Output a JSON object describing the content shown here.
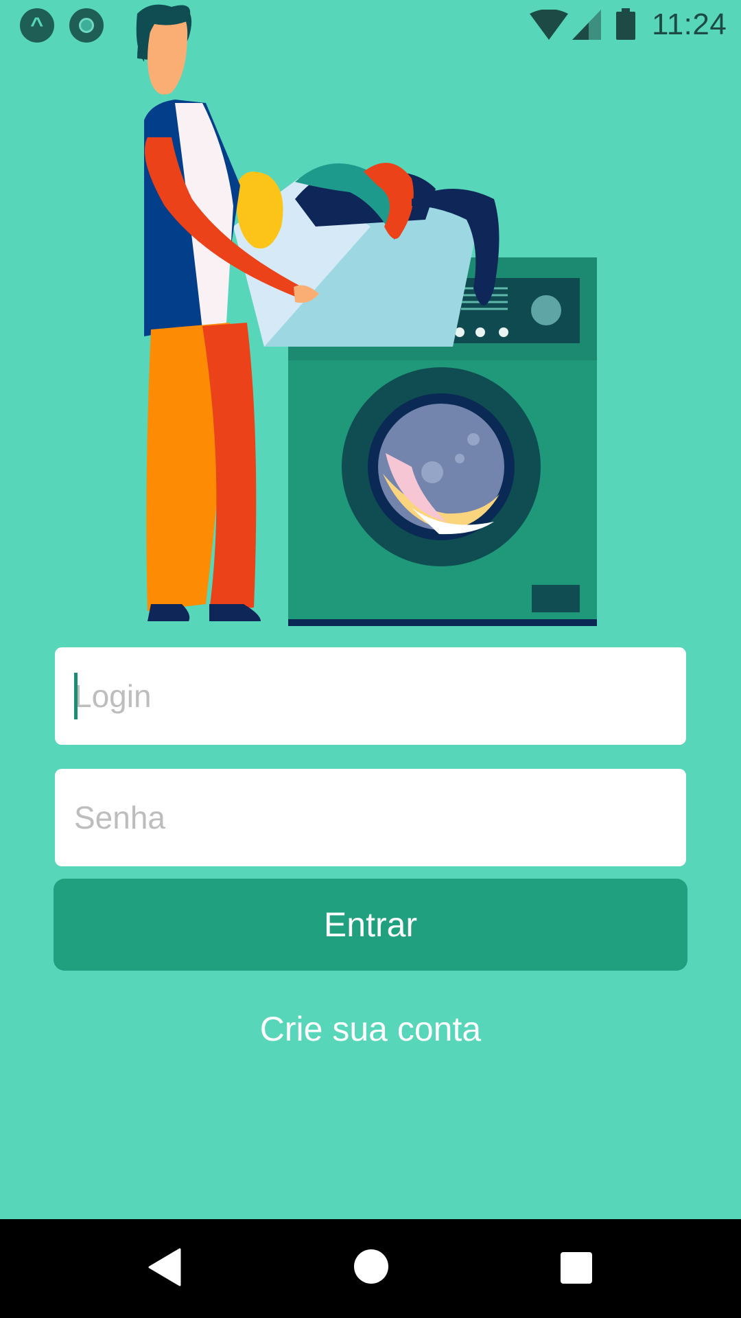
{
  "status_bar": {
    "time": "11:24",
    "left_icons": [
      "app-a-icon",
      "record-icon"
    ],
    "right_icons": [
      "wifi-icon",
      "cellular-signal-icon",
      "battery-icon"
    ]
  },
  "illustration": {
    "subject": "person-loading-washing-machine"
  },
  "form": {
    "login_placeholder": "Login",
    "password_placeholder": "Senha",
    "submit_label": "Entrar",
    "create_account_label": "Crie sua conta"
  },
  "colors": {
    "background": "#57D6BA",
    "primary_button": "#21A07F",
    "input_background": "#FFFFFF",
    "placeholder_text": "#BDBDBD",
    "nav_bar": "#000000"
  },
  "nav_bar": {
    "buttons": [
      "back-icon",
      "home-icon",
      "recent-apps-icon"
    ]
  }
}
